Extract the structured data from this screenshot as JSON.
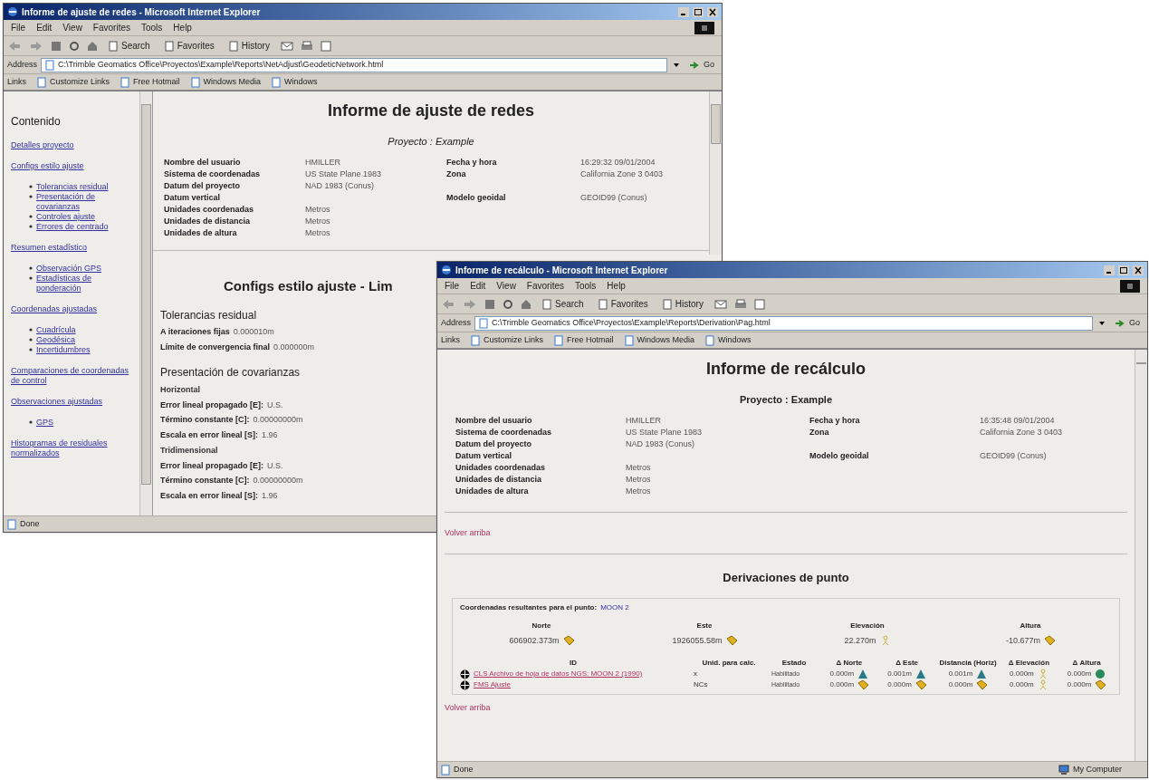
{
  "windows": [
    {
      "title": "Informe de ajuste de redes - Microsoft Internet Explorer",
      "menu": [
        "File",
        "Edit",
        "View",
        "Favorites",
        "Tools",
        "Help"
      ],
      "toolbar": [
        "Search",
        "Favorites",
        "History"
      ],
      "address_label": "Address",
      "url": "C:\\Trimble Geomatics Office\\Proyectos\\Example\\Reports\\NetAdjust\\GeodeticNetwork.html",
      "go": "Go",
      "links_label": "Links",
      "links": [
        "Customize Links",
        "Free Hotmail",
        "Windows Media",
        "Windows"
      ],
      "status": "Done",
      "sidebar": {
        "title": "Contenido",
        "items": [
          {
            "label": "Detalles proyecto"
          },
          {
            "label": "Configs estilo ajuste",
            "children": [
              {
                "label": "Tolerancias residual"
              },
              {
                "label": "Presentación de covarianzas"
              },
              {
                "label": "Controles ajuste"
              },
              {
                "label": "Errores de centrado"
              }
            ]
          },
          {
            "label": "Resumen estadístico",
            "children": [
              {
                "label": "Observación GPS"
              },
              {
                "label": "Estadísticas de ponderación"
              }
            ]
          },
          {
            "label": "Coordenadas ajustadas",
            "children": [
              {
                "label": "Cuadrícula"
              },
              {
                "label": "Geodésica"
              },
              {
                "label": "Incertidumbres"
              }
            ]
          },
          {
            "label": "Comparaciones de coordenadas de control"
          },
          {
            "label": "Observaciones ajustadas",
            "children": [
              {
                "label": "GPS"
              }
            ]
          },
          {
            "label": "Histogramas de residuales normalizados"
          }
        ]
      },
      "heading": "Informe de ajuste de redes",
      "project": "Proyecto : Example",
      "fields": [
        {
          "label": "Nombre del usuario",
          "value": "HMILLER",
          "right": {
            "label": "Fecha y hora",
            "value": "16:29:32 09/01/2004"
          }
        },
        {
          "label": "Sistema de coordenadas",
          "value": "US State Plane 1983",
          "right": {
            "label": "Zona",
            "value": "California Zone 3 0403"
          }
        },
        {
          "label": "Datum del proyecto",
          "value": "NAD 1983 (Conus)"
        },
        {
          "label": "Datum vertical",
          "right": {
            "label": "Modelo geoidal",
            "value": "GEOID99 (Conus)"
          }
        },
        {
          "label": "Unidades coordenadas",
          "value": "Metros"
        },
        {
          "label": "Unidades de distancia",
          "value": "Metros"
        },
        {
          "label": "Unidades de altura",
          "value": "Metros"
        }
      ],
      "section": "Configs estilo ajuste - Lim",
      "groups": [
        {
          "title": "Tolerancias residual",
          "sub": [
            {
              "rows": [
                {
                  "label": "A iteraciones fijas",
                  "value": "0.000010m"
                },
                {
                  "label": "Límite de convergencia final",
                  "value": "0.000000m"
                }
              ]
            }
          ]
        },
        {
          "title": "Presentación de covarianzas",
          "sub": [
            {
              "title": "Horizontal",
              "rows": [
                {
                  "label": "Error lineal propagado [E]:",
                  "value": "U.S."
                },
                {
                  "label": "Término constante [C]:",
                  "value": "0.00000000m"
                },
                {
                  "label": "Escala en error lineal [S]:",
                  "value": "1.96"
                }
              ]
            },
            {
              "title": "Tridimensional",
              "rows": [
                {
                  "label": "Error lineal propagado [E]:",
                  "value": "U.S."
                },
                {
                  "label": "Término constante [C]:",
                  "value": "0.00000000m"
                },
                {
                  "label": "Escala en error lineal [S]:",
                  "value": "1.96"
                }
              ]
            }
          ]
        }
      ]
    },
    {
      "title": "Informe de recálculo - Microsoft Internet Explorer",
      "menu": [
        "File",
        "Edit",
        "View",
        "Favorites",
        "Tools",
        "Help"
      ],
      "toolbar": [
        "Search",
        "Favorites",
        "History"
      ],
      "address_label": "Address",
      "url": "C:\\Trimble Geomatics Office\\Proyectos\\Example\\Reports\\Derivation\\Pag.html",
      "go": "Go",
      "links_label": "Links",
      "links": [
        "Customize Links",
        "Free Hotmail",
        "Windows Media",
        "Windows"
      ],
      "status": "Done",
      "zone": "My Computer",
      "heading": "Informe de recálculo",
      "project": "Proyecto : Example",
      "fields": [
        {
          "label": "Nombre del usuario",
          "value": "HMILLER",
          "right": {
            "label": "Fecha y hora",
            "value": "16:35:48 09/01/2004"
          }
        },
        {
          "label": "Sistema de coordenadas",
          "value": "US State Plane 1983",
          "right": {
            "label": "Zona",
            "value": "California Zone 3 0403"
          }
        },
        {
          "label": "Datum del proyecto",
          "value": "NAD 1983 (Conus)"
        },
        {
          "label": "Datum vertical",
          "right": {
            "label": "Modelo geoidal",
            "value": "GEOID99 (Conus)"
          }
        },
        {
          "label": "Unidades coordenadas",
          "value": "Metros"
        },
        {
          "label": "Unidades de distancia",
          "value": "Metros"
        },
        {
          "label": "Unidades de altura",
          "value": "Metros"
        }
      ],
      "back_link": "Volver arriba",
      "section": "Derivaciones de punto",
      "result": {
        "caption": "Coordenadas resultantes para el punto:",
        "point": "MOON 2",
        "coords": [
          {
            "label": "Norte",
            "value": "606902.373m",
            "kind": "tag"
          },
          {
            "label": "Este",
            "value": "1926055.58m",
            "kind": "tag"
          },
          {
            "label": "Elevación",
            "value": "22.270m",
            "kind": "figure"
          },
          {
            "label": "Altura",
            "value": "-10.677m",
            "kind": "tag"
          }
        ],
        "columns": [
          "ID",
          "Unid. para calc.",
          "Estado",
          "Δ Norte",
          "Δ Este",
          "Distancia (Horiz)",
          "Δ Elevación",
          "Δ Altura"
        ],
        "rows": [
          {
            "id": "CLS Archivo de hoja de datos NGS: MOON 2 (1990)",
            "unit": "x",
            "state": "Habilitado",
            "values": [
              {
                "text": "0.000m",
                "kind": "triangle"
              },
              {
                "text": "0.001m",
                "kind": "triangle"
              },
              {
                "text": "0.001m",
                "kind": "triangle"
              },
              {
                "text": "0.000m",
                "kind": "figure"
              },
              {
                "text": "0.000m",
                "kind": "ball"
              }
            ]
          },
          {
            "id": "FMS Ajuste",
            "unit": "NCs",
            "state": "Habilitado",
            "values": [
              {
                "text": "0.000m",
                "kind": "tag"
              },
              {
                "text": "0.000m",
                "kind": "tag"
              },
              {
                "text": "0.000m",
                "kind": "tag"
              },
              {
                "text": "0.000m",
                "kind": "figure"
              },
              {
                "text": "0.000m",
                "kind": "tag"
              }
            ]
          }
        ]
      },
      "back_link_2": "Volver arriba"
    }
  ]
}
